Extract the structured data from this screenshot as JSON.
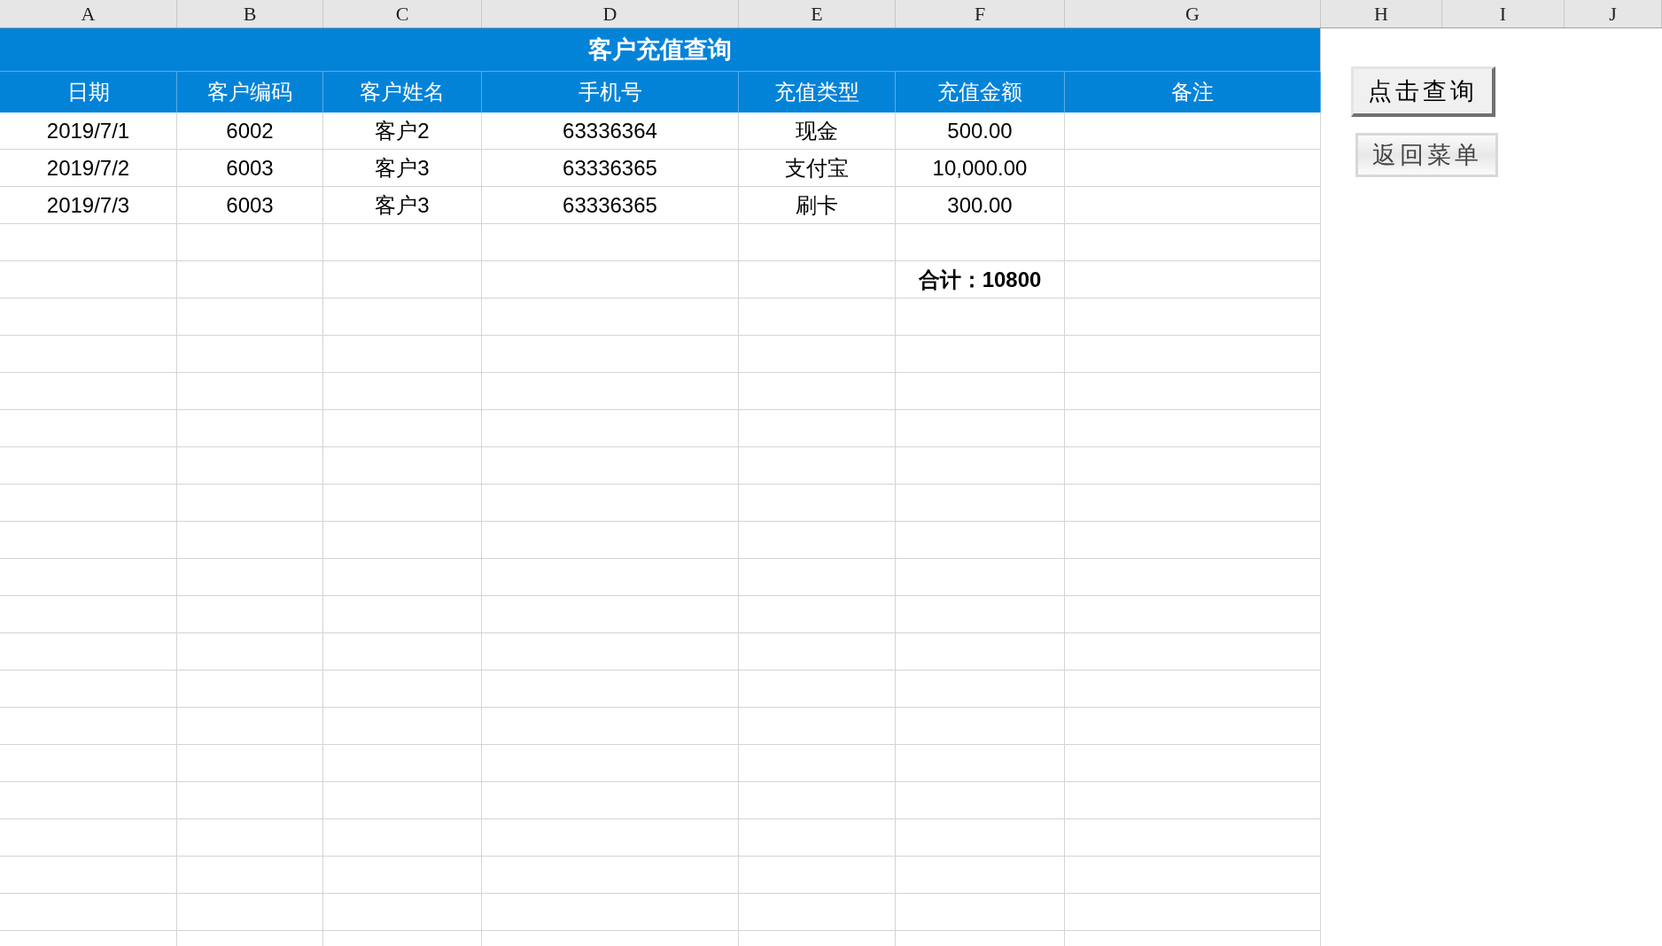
{
  "column_letters": [
    "A",
    "B",
    "C",
    "D",
    "E",
    "F",
    "G",
    "H",
    "I",
    "J"
  ],
  "table": {
    "title": "客户充值查询",
    "columns": [
      "日期",
      "客户编码",
      "客户姓名",
      "手机号",
      "充值类型",
      "充值金额",
      "备注"
    ],
    "rows": [
      {
        "cells": [
          "2019/7/1",
          "6002",
          "客户2",
          "63336364",
          "现金",
          "500.00",
          ""
        ]
      },
      {
        "cells": [
          "2019/7/2",
          "6003",
          "客户3",
          "63336365",
          "支付宝",
          "10,000.00",
          ""
        ]
      },
      {
        "cells": [
          "2019/7/3",
          "6003",
          "客户3",
          "63336365",
          "刷卡",
          "300.00",
          ""
        ]
      }
    ],
    "total": "合计：10800"
  },
  "buttons": [
    {
      "label": "点击查询",
      "kind": "raised"
    },
    {
      "label": "返回菜单",
      "kind": "flat"
    }
  ]
}
